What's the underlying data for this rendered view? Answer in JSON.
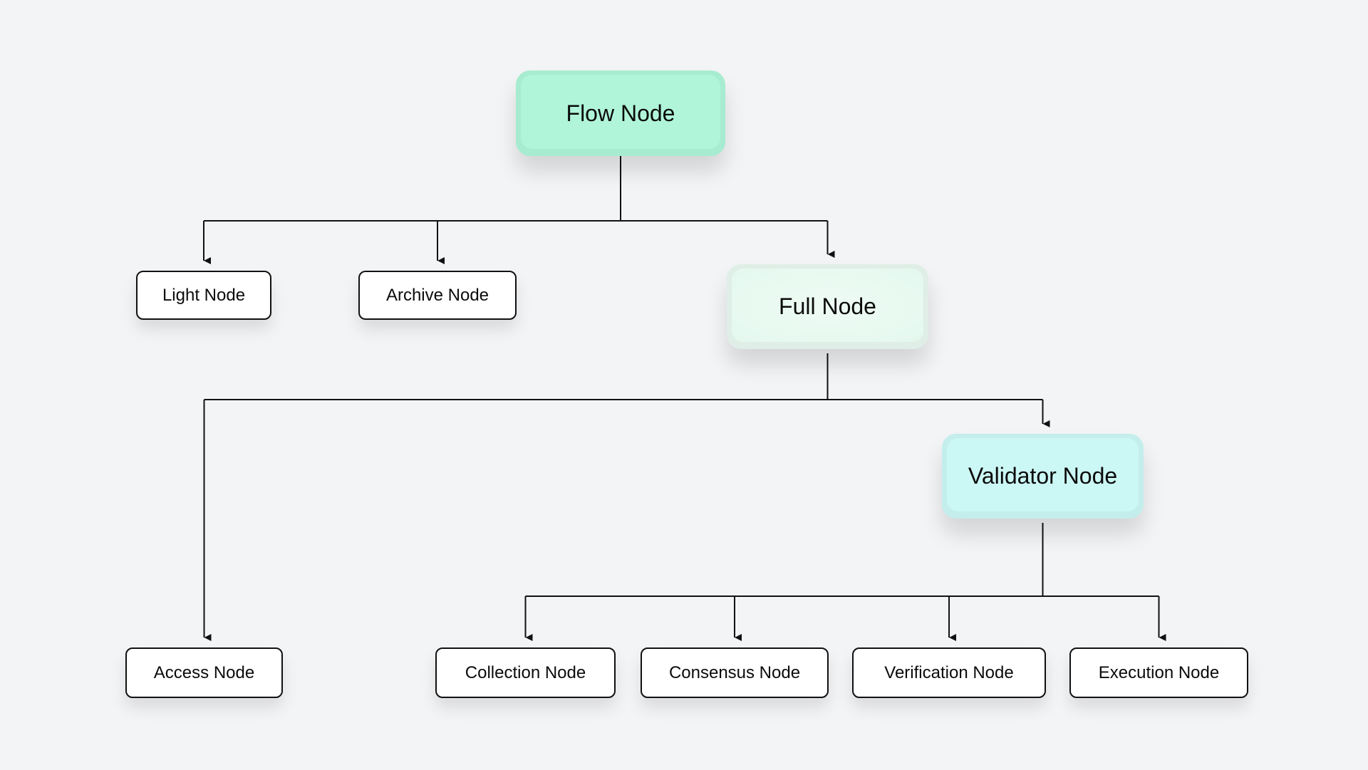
{
  "diagram": {
    "type": "hierarchy",
    "colors": {
      "background": "#f3f4f6",
      "flow": "#b0f5da",
      "full": "#e6f9ef",
      "validator": "#cbf7f4",
      "leaf": "#ffffff",
      "line": "#111111"
    },
    "nodes": [
      {
        "id": "flow",
        "label": "Flow Node",
        "level": 0,
        "style": "primary"
      },
      {
        "id": "light",
        "label": "Light Node",
        "level": 1,
        "parent": "flow",
        "style": "leaf"
      },
      {
        "id": "archive",
        "label": "Archive Node",
        "level": 1,
        "parent": "flow",
        "style": "leaf"
      },
      {
        "id": "full",
        "label": "Full Node",
        "level": 1,
        "parent": "flow",
        "style": "primary"
      },
      {
        "id": "validator",
        "label": "Validator Node",
        "level": 2,
        "parent": "full",
        "style": "primary"
      },
      {
        "id": "access",
        "label": "Access Node",
        "level": 3,
        "parent": "full",
        "style": "leaf"
      },
      {
        "id": "collection",
        "label": "Collection Node",
        "level": 3,
        "parent": "validator",
        "style": "leaf"
      },
      {
        "id": "consensus",
        "label": "Consensus Node",
        "level": 3,
        "parent": "validator",
        "style": "leaf"
      },
      {
        "id": "verification",
        "label": "Verification Node",
        "level": 3,
        "parent": "validator",
        "style": "leaf"
      },
      {
        "id": "execution",
        "label": "Execution Node",
        "level": 3,
        "parent": "validator",
        "style": "leaf"
      }
    ],
    "edges": [
      [
        "flow",
        "light"
      ],
      [
        "flow",
        "archive"
      ],
      [
        "flow",
        "full"
      ],
      [
        "full",
        "access"
      ],
      [
        "full",
        "validator"
      ],
      [
        "validator",
        "collection"
      ],
      [
        "validator",
        "consensus"
      ],
      [
        "validator",
        "verification"
      ],
      [
        "validator",
        "execution"
      ]
    ]
  }
}
